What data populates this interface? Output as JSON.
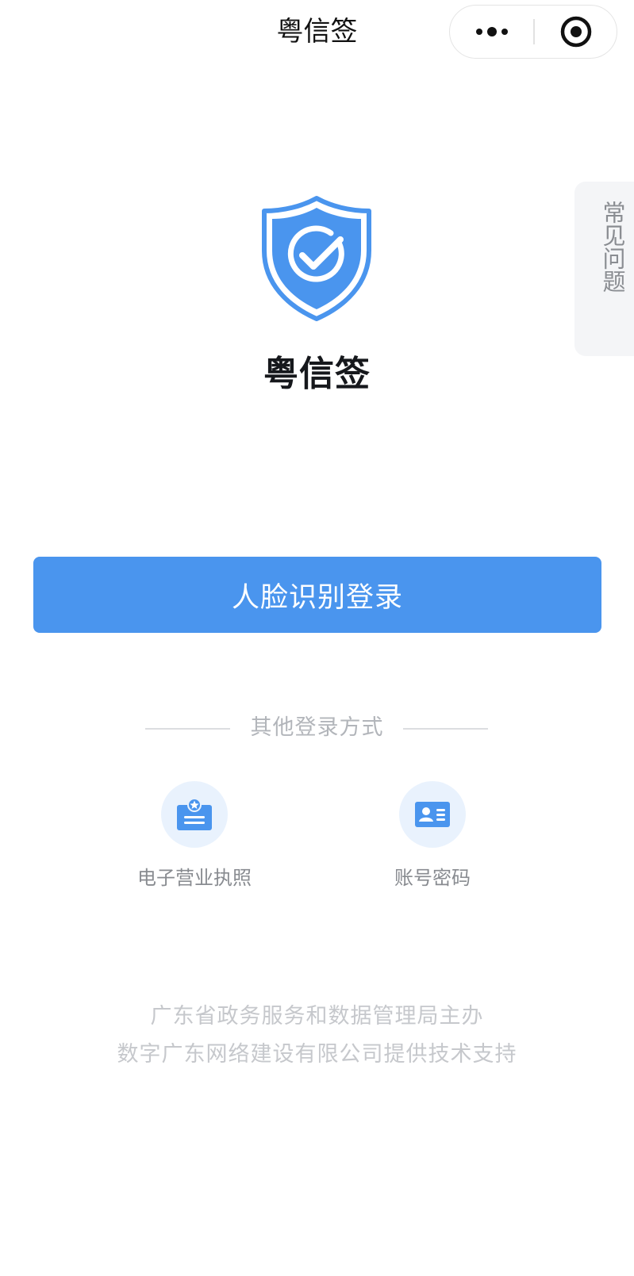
{
  "navbar": {
    "title": "粤信签",
    "more_icon": "more-dots-icon",
    "close_icon": "target-close-icon"
  },
  "faq_tab": {
    "label": "常见问题"
  },
  "logo": {
    "icon": "shield-check-icon",
    "app_name": "粤信签"
  },
  "primary_login": {
    "label": "人脸识别登录"
  },
  "other_login": {
    "label": "其他登录方式",
    "options": [
      {
        "label": "电子营业执照",
        "icon": "business-license-icon"
      },
      {
        "label": "账号密码",
        "icon": "id-card-icon"
      }
    ]
  },
  "footer": {
    "line1": "广东省政务服务和数据管理局主办",
    "line2": "数字广东网络建设有限公司提供技术支持"
  },
  "colors": {
    "accent": "#4a95ee",
    "accent_light": "#e9f2fd",
    "text_muted": "#888b90",
    "footer_text": "#c6c8cc"
  }
}
